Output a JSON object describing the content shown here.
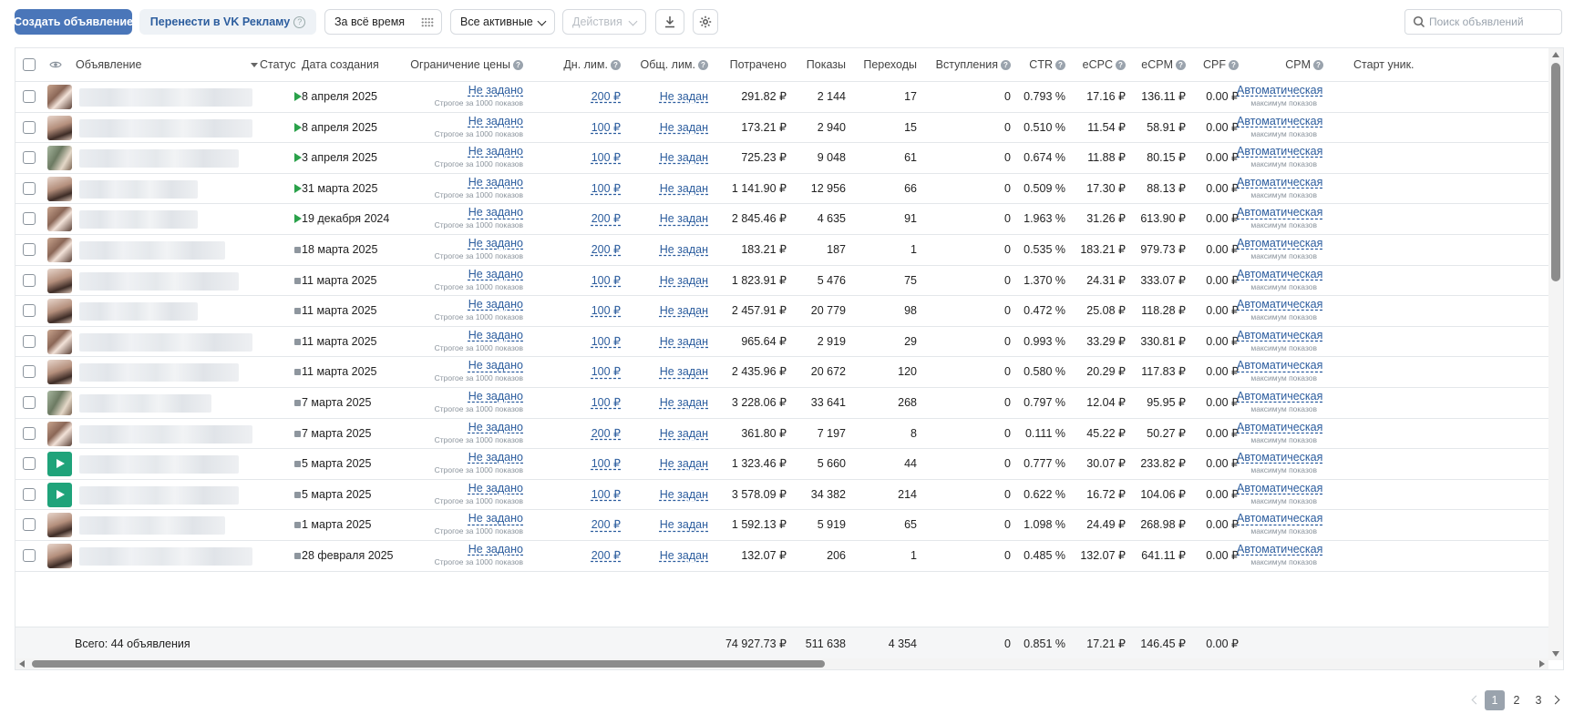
{
  "toolbar": {
    "create_label": "Создать объявление",
    "migrate_label": "Перенести в VK Рекламу",
    "period_label": "За всё время",
    "filter_label": "Все активные",
    "actions_label": "Действия",
    "search_placeholder": "Поиск объявлений"
  },
  "columns": {
    "ad": "Объявление",
    "status": "Статус",
    "created": "Дата создания",
    "price_limit": "Ограничение цены",
    "day_limit": "Дн. лим.",
    "total_limit": "Общ. лим.",
    "spent": "Потрачено",
    "impressions": "Показы",
    "clicks": "Переходы",
    "joins": "Вступления",
    "ctr": "CTR",
    "ecpc": "eCPC",
    "ecpm": "eCPM",
    "cpf": "CPF",
    "cpm": "CPM",
    "unique_start": "Старт уник."
  },
  "price_limit_value": "Не задано",
  "price_limit_sub": "Строгое за 1000 показов",
  "total_limit_value": "Не задан",
  "cpm_value": "Автоматическая",
  "cpm_sub": "максимум показов",
  "rows": [
    {
      "status": "active",
      "thumb": "photo",
      "date": "8 апреля 2025",
      "day_limit": "200 ₽",
      "spent": "291.82 ₽",
      "impressions": "2 144",
      "clicks": "17",
      "joins": "0",
      "ctr": "0.793 %",
      "ecpc": "17.16 ₽",
      "ecpm": "136.11 ₽",
      "cpf": "0.00 ₽"
    },
    {
      "status": "active",
      "thumb": "photo2",
      "date": "8 апреля 2025",
      "day_limit": "100 ₽",
      "spent": "173.21 ₽",
      "impressions": "2 940",
      "clicks": "15",
      "joins": "0",
      "ctr": "0.510 %",
      "ecpc": "11.54 ₽",
      "ecpm": "58.91 ₽",
      "cpf": "0.00 ₽"
    },
    {
      "status": "active",
      "thumb": "photo3",
      "date": "3 апреля 2025",
      "day_limit": "100 ₽",
      "spent": "725.23 ₽",
      "impressions": "9 048",
      "clicks": "61",
      "joins": "0",
      "ctr": "0.674 %",
      "ecpc": "11.88 ₽",
      "ecpm": "80.15 ₽",
      "cpf": "0.00 ₽"
    },
    {
      "status": "active",
      "thumb": "photo2",
      "date": "31 марта 2025",
      "day_limit": "100 ₽",
      "spent": "1 141.90 ₽",
      "impressions": "12 956",
      "clicks": "66",
      "joins": "0",
      "ctr": "0.509 %",
      "ecpc": "17.30 ₽",
      "ecpm": "88.13 ₽",
      "cpf": "0.00 ₽"
    },
    {
      "status": "active",
      "thumb": "photo",
      "date": "19 декабря 2024",
      "day_limit": "200 ₽",
      "spent": "2 845.46 ₽",
      "impressions": "4 635",
      "clicks": "91",
      "joins": "0",
      "ctr": "1.963 %",
      "ecpc": "31.26 ₽",
      "ecpm": "613.90 ₽",
      "cpf": "0.00 ₽"
    },
    {
      "status": "stopped",
      "thumb": "photo",
      "date": "18 марта 2025",
      "day_limit": "200 ₽",
      "spent": "183.21 ₽",
      "impressions": "187",
      "clicks": "1",
      "joins": "0",
      "ctr": "0.535 %",
      "ecpc": "183.21 ₽",
      "ecpm": "979.73 ₽",
      "cpf": "0.00 ₽"
    },
    {
      "status": "stopped",
      "thumb": "photo2",
      "date": "11 марта 2025",
      "day_limit": "100 ₽",
      "spent": "1 823.91 ₽",
      "impressions": "5 476",
      "clicks": "75",
      "joins": "0",
      "ctr": "1.370 %",
      "ecpc": "24.31 ₽",
      "ecpm": "333.07 ₽",
      "cpf": "0.00 ₽"
    },
    {
      "status": "stopped",
      "thumb": "photo2",
      "date": "11 марта 2025",
      "day_limit": "100 ₽",
      "spent": "2 457.91 ₽",
      "impressions": "20 779",
      "clicks": "98",
      "joins": "0",
      "ctr": "0.472 %",
      "ecpc": "25.08 ₽",
      "ecpm": "118.28 ₽",
      "cpf": "0.00 ₽"
    },
    {
      "status": "stopped",
      "thumb": "photo",
      "date": "11 марта 2025",
      "day_limit": "100 ₽",
      "spent": "965.64 ₽",
      "impressions": "2 919",
      "clicks": "29",
      "joins": "0",
      "ctr": "0.993 %",
      "ecpc": "33.29 ₽",
      "ecpm": "330.81 ₽",
      "cpf": "0.00 ₽"
    },
    {
      "status": "stopped",
      "thumb": "photo2",
      "date": "11 марта 2025",
      "day_limit": "100 ₽",
      "spent": "2 435.96 ₽",
      "impressions": "20 672",
      "clicks": "120",
      "joins": "0",
      "ctr": "0.580 %",
      "ecpc": "20.29 ₽",
      "ecpm": "117.83 ₽",
      "cpf": "0.00 ₽"
    },
    {
      "status": "stopped",
      "thumb": "photo3",
      "date": "7 марта 2025",
      "day_limit": "100 ₽",
      "spent": "3 228.06 ₽",
      "impressions": "33 641",
      "clicks": "268",
      "joins": "0",
      "ctr": "0.797 %",
      "ecpc": "12.04 ₽",
      "ecpm": "95.95 ₽",
      "cpf": "0.00 ₽"
    },
    {
      "status": "stopped",
      "thumb": "photo",
      "date": "7 марта 2025",
      "day_limit": "200 ₽",
      "spent": "361.80 ₽",
      "impressions": "7 197",
      "clicks": "8",
      "joins": "0",
      "ctr": "0.111 %",
      "ecpc": "45.22 ₽",
      "ecpm": "50.27 ₽",
      "cpf": "0.00 ₽"
    },
    {
      "status": "stopped",
      "thumb": "video",
      "date": "5 марта 2025",
      "day_limit": "100 ₽",
      "spent": "1 323.46 ₽",
      "impressions": "5 660",
      "clicks": "44",
      "joins": "0",
      "ctr": "0.777 %",
      "ecpc": "30.07 ₽",
      "ecpm": "233.82 ₽",
      "cpf": "0.00 ₽"
    },
    {
      "status": "stopped",
      "thumb": "video",
      "date": "5 марта 2025",
      "day_limit": "100 ₽",
      "spent": "3 578.09 ₽",
      "impressions": "34 382",
      "clicks": "214",
      "joins": "0",
      "ctr": "0.622 %",
      "ecpc": "16.72 ₽",
      "ecpm": "104.06 ₽",
      "cpf": "0.00 ₽"
    },
    {
      "status": "stopped",
      "thumb": "photo2",
      "date": "1 марта 2025",
      "day_limit": "200 ₽",
      "spent": "1 592.13 ₽",
      "impressions": "5 919",
      "clicks": "65",
      "joins": "0",
      "ctr": "1.098 %",
      "ecpc": "24.49 ₽",
      "ecpm": "268.98 ₽",
      "cpf": "0.00 ₽"
    },
    {
      "status": "stopped",
      "thumb": "photo2",
      "date": "28 февраля 2025",
      "day_limit": "200 ₽",
      "spent": "132.07 ₽",
      "impressions": "206",
      "clicks": "1",
      "joins": "0",
      "ctr": "0.485 %",
      "ecpc": "132.07 ₽",
      "ecpm": "641.11 ₽",
      "cpf": "0.00 ₽"
    }
  ],
  "totals": {
    "label": "Всего: 44 объявления",
    "spent": "74 927.73 ₽",
    "impressions": "511 638",
    "clicks": "4 354",
    "joins": "0",
    "ctr": "0.851 %",
    "ecpc": "17.21 ₽",
    "ecpm": "146.45 ₽",
    "cpf": "0.00 ₽"
  },
  "pagination": {
    "pages": [
      "1",
      "2",
      "3"
    ],
    "current": "1"
  },
  "colors": {
    "primary": "#4a76b9",
    "link": "#2c5d9e",
    "active_status": "#2aa14a",
    "video_thumb": "#1fa37a"
  }
}
